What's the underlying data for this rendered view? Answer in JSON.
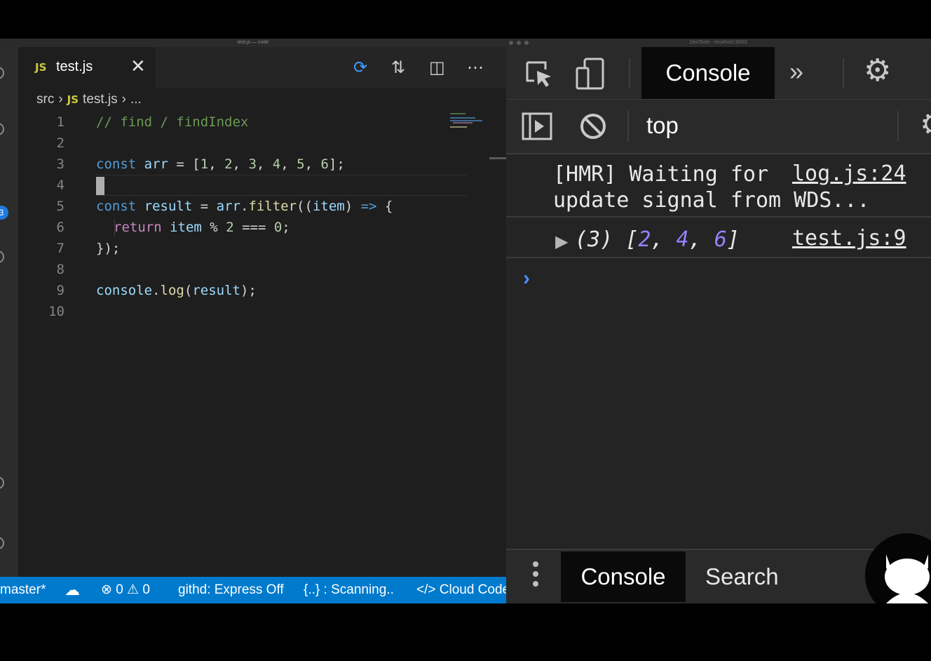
{
  "editor": {
    "window_title": "test.js — code",
    "tab": {
      "lang_badge": "JS",
      "filename": "test.js"
    },
    "breadcrumb": {
      "folder": "src",
      "lang_badge": "JS",
      "file": "test.js",
      "more": "..."
    },
    "activity_badge": "3",
    "line_numbers": [
      "1",
      "2",
      "3",
      "4",
      "5",
      "6",
      "7",
      "8",
      "9",
      "10"
    ],
    "code": {
      "line1": "// find / findIndex",
      "line3": {
        "kw": "const",
        "name": "arr",
        "eq": " = [",
        "n1": "1",
        "n2": "2",
        "n3": "3",
        "n4": "4",
        "n5": "5",
        "n6": "6",
        "end": "];"
      },
      "line5": {
        "kw": "const",
        "name": "result",
        "eq": " = ",
        "obj": "arr",
        "dot": ".",
        "fn": "filter",
        "open": "((",
        "param": "item",
        "arrow_pre": ") ",
        "arrow": "=>",
        "brace": " {"
      },
      "line6": {
        "kw": "return",
        "var": "item",
        "op": " % ",
        "n1": "2",
        "op2": " === ",
        "n2": "0",
        "end": ";"
      },
      "line7": "});",
      "line9": {
        "obj": "console",
        "dot": ".",
        "fn": "log",
        "open": "(",
        "arg": "result",
        "end": ");"
      }
    },
    "status": {
      "branch": "master*",
      "problems": "⊗ 0 ⚠ 0",
      "githd": "githd: Express Off",
      "scanning": "{..} : Scanning..",
      "cloud_code": "</> Cloud Code"
    }
  },
  "devtools": {
    "window_title": "DevTools - localhost:3000/",
    "tabs": {
      "active": "Console"
    },
    "context": "top",
    "messages": [
      {
        "text": "[HMR] Waiting for\nupdate signal from WDS...",
        "source": "log.js:24"
      },
      {
        "count": "(3)",
        "open": "[",
        "v1": "2",
        "v2": "4",
        "v3": "6",
        "close": "]",
        "source": "test.js:9"
      }
    ],
    "drawer": {
      "console": "Console",
      "search": "Search"
    }
  },
  "colors": {
    "accent": "#007acc",
    "js_badge": "#cbcb41",
    "devtools_number": "#9980ff",
    "prompt": "#4a8cff"
  }
}
